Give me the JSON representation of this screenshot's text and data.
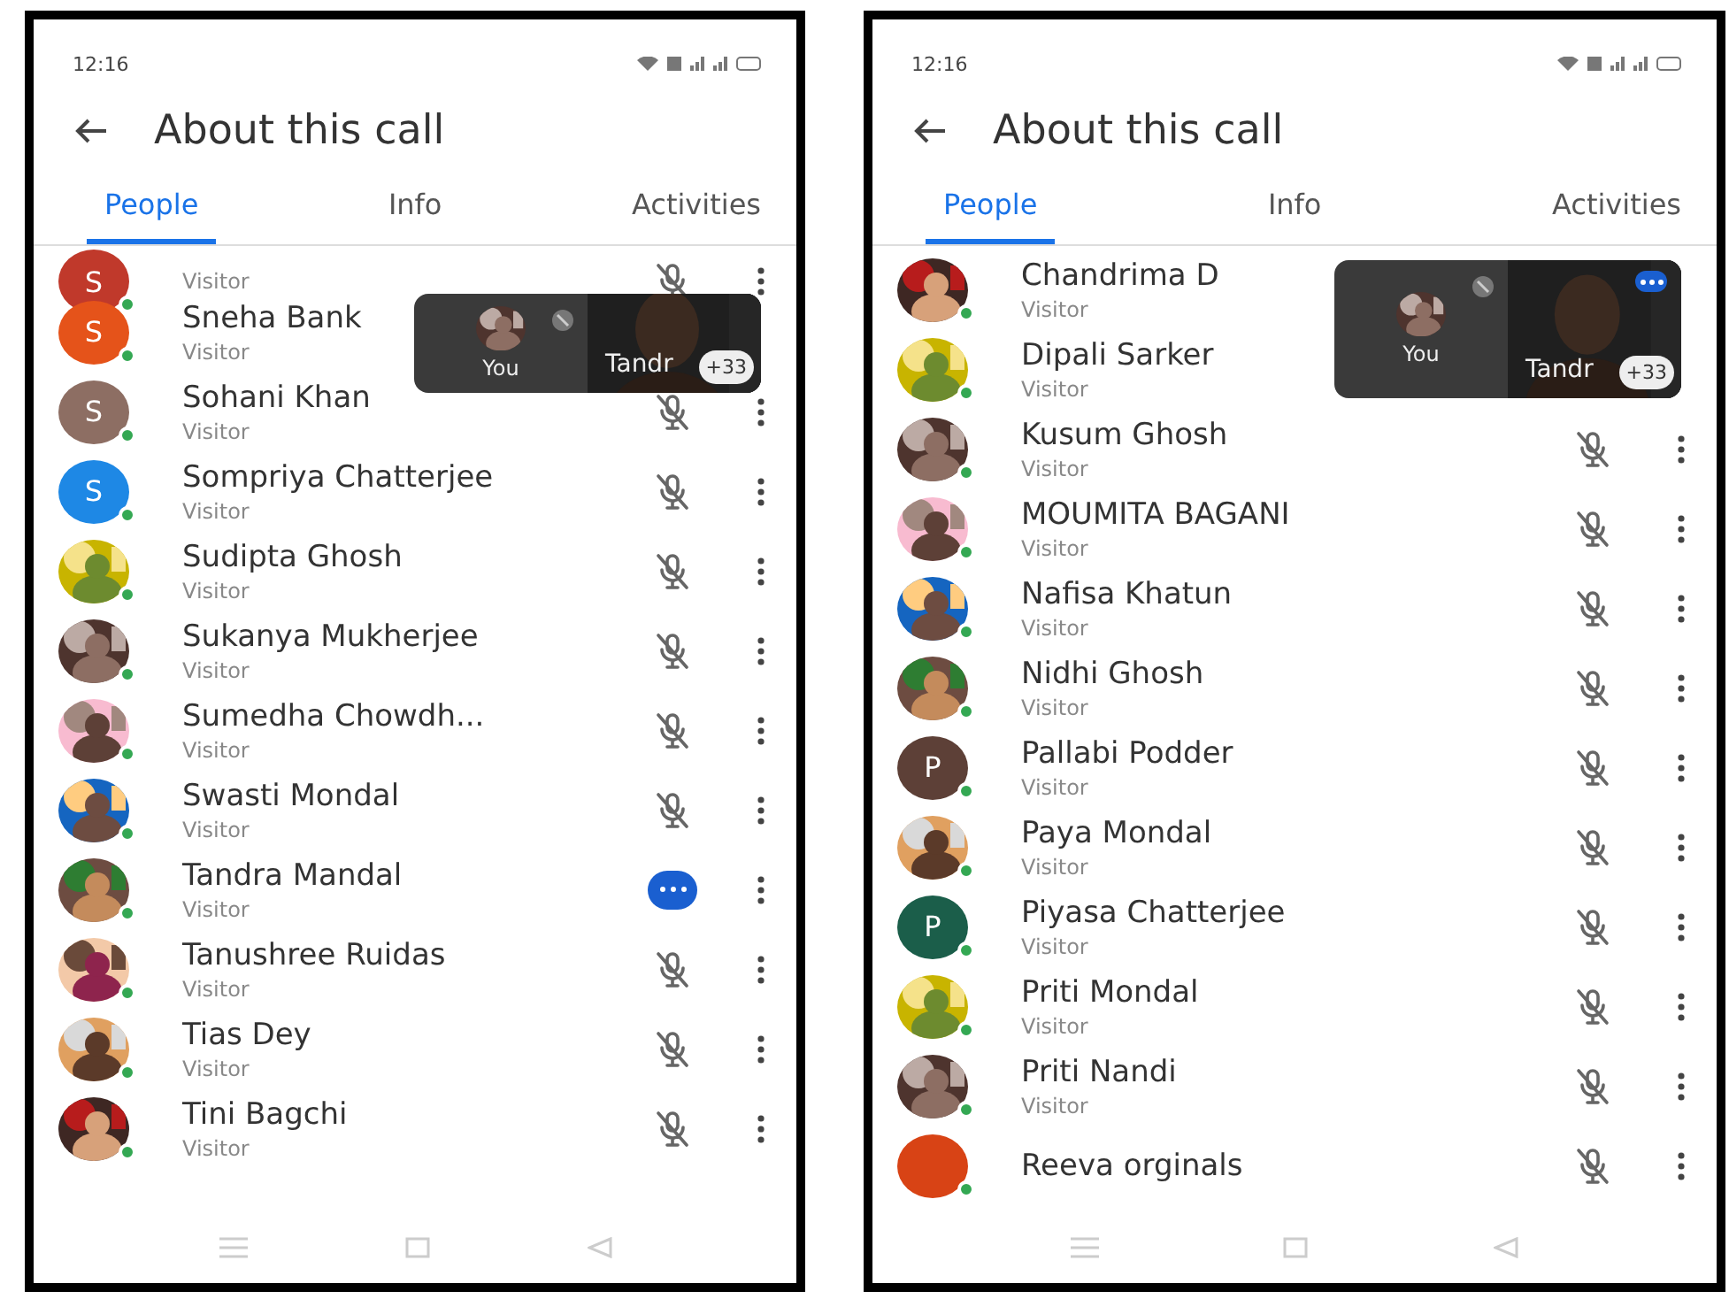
{
  "phones": [
    {
      "status_bar": {
        "time": "12:16"
      },
      "title": "About this call",
      "tabs": [
        {
          "label": "People",
          "selected": true
        },
        {
          "label": "Info",
          "selected": false
        },
        {
          "label": "Activities",
          "selected": false
        }
      ],
      "overlay": {
        "self_label": "You",
        "other_label": "Tandr",
        "more_count": "+33",
        "other_speaking": false
      },
      "people": [
        {
          "role": "Visitor",
          "avatar": {
            "kind": "letter",
            "letter": "S",
            "color": "#c0392b"
          },
          "kind": "muted"
        },
        {
          "name": "Sneha Bank",
          "role": "Visitor",
          "avatar": {
            "kind": "letter",
            "letter": "S",
            "color": "#e5531a"
          },
          "kind": "covered"
        },
        {
          "name": "Sohani Khan",
          "role": "Visitor",
          "avatar": {
            "kind": "letter",
            "letter": "S",
            "color": "#8d6e63"
          },
          "kind": "muted"
        },
        {
          "name": "Sompriya Chatterjee",
          "role": "Visitor",
          "avatar": {
            "kind": "letter",
            "letter": "S",
            "color": "#1e88e5"
          },
          "kind": "muted"
        },
        {
          "name": "Sudipta Ghosh",
          "role": "Visitor",
          "kind": "muted"
        },
        {
          "name": "Sukanya Mukherjee",
          "role": "Visitor",
          "kind": "muted"
        },
        {
          "name": "Sumedha Chowdh...",
          "role": "Visitor",
          "kind": "muted"
        },
        {
          "name": "Swasti Mondal",
          "role": "Visitor",
          "kind": "muted"
        },
        {
          "name": "Tandra Mandal",
          "role": "Visitor",
          "kind": "speaking"
        },
        {
          "name": "Tanushree Ruidas",
          "role": "Visitor",
          "kind": "muted"
        },
        {
          "name": "Tias Dey",
          "role": "Visitor",
          "kind": "muted"
        },
        {
          "name": "Tini Bagchi",
          "role": "Visitor",
          "kind": "muted"
        }
      ]
    },
    {
      "status_bar": {
        "time": "12:16"
      },
      "title": "About this call",
      "tabs": [
        {
          "label": "People",
          "selected": true
        },
        {
          "label": "Info",
          "selected": false
        },
        {
          "label": "Activities",
          "selected": false
        }
      ],
      "overlay": {
        "self_label": "You",
        "other_label": "Tandr",
        "more_count": "+33",
        "other_speaking": true
      },
      "people": [
        {
          "name": "Chandrima D",
          "role": "Visitor",
          "kind": "covered"
        },
        {
          "name": "Dipali Sarker",
          "role": "Visitor",
          "kind": "covered"
        },
        {
          "name": "Kusum Ghosh",
          "role": "Visitor",
          "kind": "muted"
        },
        {
          "name": "MOUMITA BAGANI",
          "role": "Visitor",
          "kind": "muted"
        },
        {
          "name": "Nafisa Khatun",
          "role": "Visitor",
          "kind": "muted"
        },
        {
          "name": "Nidhi Ghosh",
          "role": "Visitor",
          "kind": "muted"
        },
        {
          "name": "Pallabi Podder",
          "role": "Visitor",
          "avatar": {
            "kind": "letter",
            "letter": "P",
            "color": "#5d4037"
          },
          "kind": "muted"
        },
        {
          "name": "Paya Mondal",
          "role": "Visitor",
          "kind": "muted"
        },
        {
          "name": "Piyasa Chatterjee",
          "role": "Visitor",
          "avatar": {
            "kind": "letter",
            "letter": "P",
            "color": "#1b5e4a"
          },
          "kind": "muted"
        },
        {
          "name": "Priti Mondal",
          "role": "Visitor",
          "kind": "muted"
        },
        {
          "name": "Priti Nandi",
          "role": "Visitor",
          "kind": "muted"
        },
        {
          "name": "Reeva orginals",
          "avatar": {
            "kind": "letter",
            "color": "#d84315"
          },
          "kind": "muted"
        }
      ]
    }
  ]
}
